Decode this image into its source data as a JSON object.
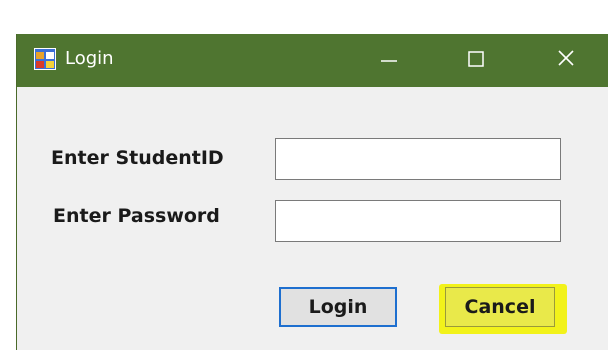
{
  "window": {
    "title": "Login",
    "icon": "form-app-icon",
    "controls": [
      "minimize-icon",
      "maximize-icon",
      "close-icon"
    ],
    "titlebar_color": "#4f7530"
  },
  "form": {
    "student_id_label": "Enter StudentID",
    "student_id_value": "",
    "password_label": "Enter Password",
    "password_value": ""
  },
  "buttons": {
    "login_label": "Login",
    "cancel_label": "Cancel",
    "login_focus_color": "#1e6fcf",
    "cancel_highlight_color": "#f2f21a"
  }
}
